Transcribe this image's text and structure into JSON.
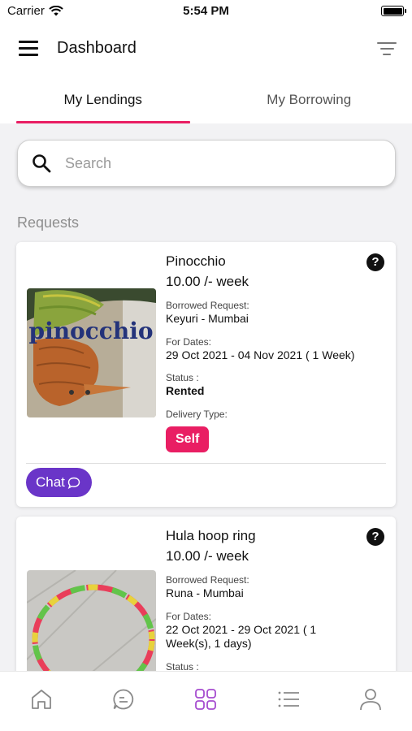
{
  "status_bar": {
    "carrier": "Carrier",
    "time": "5:54 PM"
  },
  "app_bar": {
    "title": "Dashboard"
  },
  "tabs": [
    {
      "label": "My Lendings",
      "active": true
    },
    {
      "label": "My Borrowing",
      "active": false
    }
  ],
  "search": {
    "placeholder": "Search",
    "value": ""
  },
  "section_title": "Requests",
  "requests": [
    {
      "name": "Pinocchio",
      "price": "10.00 /- week",
      "borrowed_label": "Borrowed Request:",
      "borrower": "Keyuri - Mumbai",
      "dates_label": "For Dates:",
      "dates": "29 Oct 2021 - 04 Nov 2021 ( 1 Week)",
      "status_label": "Status :",
      "status": "Rented",
      "delivery_label": "Delivery Type:",
      "delivery": "Self",
      "chat_label": "Chat",
      "image_text": "pinocchio"
    },
    {
      "name": "Hula hoop ring",
      "price": "10.00 /- week",
      "borrowed_label": "Borrowed Request:",
      "borrower": "Runa - Mumbai",
      "dates_label": "For Dates:",
      "dates": "22 Oct 2021 - 29 Oct 2021 ( 1 Week(s), 1 days)",
      "status_label": "Status :"
    }
  ],
  "bottom_nav": [
    {
      "icon": "home-icon",
      "active": false
    },
    {
      "icon": "chat-icon",
      "active": false
    },
    {
      "icon": "dashboard-grid-icon",
      "active": true
    },
    {
      "icon": "list-icon",
      "active": false
    },
    {
      "icon": "profile-icon",
      "active": false
    }
  ],
  "colors": {
    "accent": "#e91e63",
    "chat": "#6a35c8",
    "active_nav": "#a64ccf"
  }
}
